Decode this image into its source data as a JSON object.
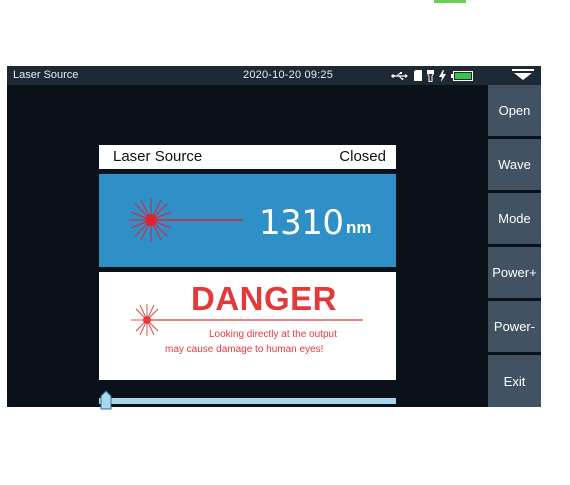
{
  "status_bar": {
    "title": "Laser Source",
    "datetime": "2020-10-20 09:25",
    "icons": [
      "usb-icon",
      "sd-card-icon",
      "flashlight-icon",
      "charging-icon",
      "battery-icon"
    ],
    "menu_icon": "dropdown-arrow-icon"
  },
  "panel": {
    "title": "Laser Source",
    "status": "Closed"
  },
  "wavelength": {
    "value": "1310",
    "unit": "nm"
  },
  "warning": {
    "title": "DANGER",
    "line1": "Looking directly at the output",
    "line2": "may cause damage to human eyes!"
  },
  "sidebar": {
    "buttons": [
      {
        "label": "Open"
      },
      {
        "label": "Wave"
      },
      {
        "label": "Mode"
      },
      {
        "label": "Power+"
      },
      {
        "label": "Power-"
      },
      {
        "label": "Exit"
      }
    ]
  },
  "power_slider": {
    "level": 0.0
  },
  "colors": {
    "screen_bg": "#0b1119",
    "statusbar_bg": "#1d2a36",
    "button_bg": "#415262",
    "wave_panel": "#2f8fc7",
    "danger_red": "#e23a3a",
    "slider_track": "#a9d8ec",
    "battery_green": "#39c24a"
  }
}
